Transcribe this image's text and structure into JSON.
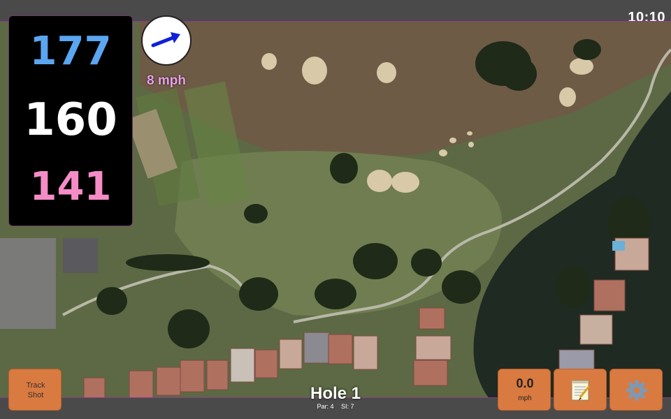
{
  "status": {
    "time": "10:10"
  },
  "distances": {
    "back": "177",
    "center": "160",
    "front": "141"
  },
  "wind": {
    "speed_label": "8 mph",
    "direction_icon": "arrow-right-icon"
  },
  "hole": {
    "title": "Hole 1",
    "par": "Par: 4",
    "stroke_index": "SI: 7"
  },
  "buttons": {
    "track_shot_line1": "Track",
    "track_shot_line2": "Shot",
    "wind_value": "0.0",
    "wind_unit": "mph",
    "notes_icon": "notepad-icon",
    "settings_icon": "gear-icon"
  },
  "colors": {
    "back_distance": "#5aa6f0",
    "center_distance": "#ffffff",
    "front_distance": "#f58cc6",
    "button_accent": "#d97a40",
    "wind_label": "#e8a0e8"
  }
}
